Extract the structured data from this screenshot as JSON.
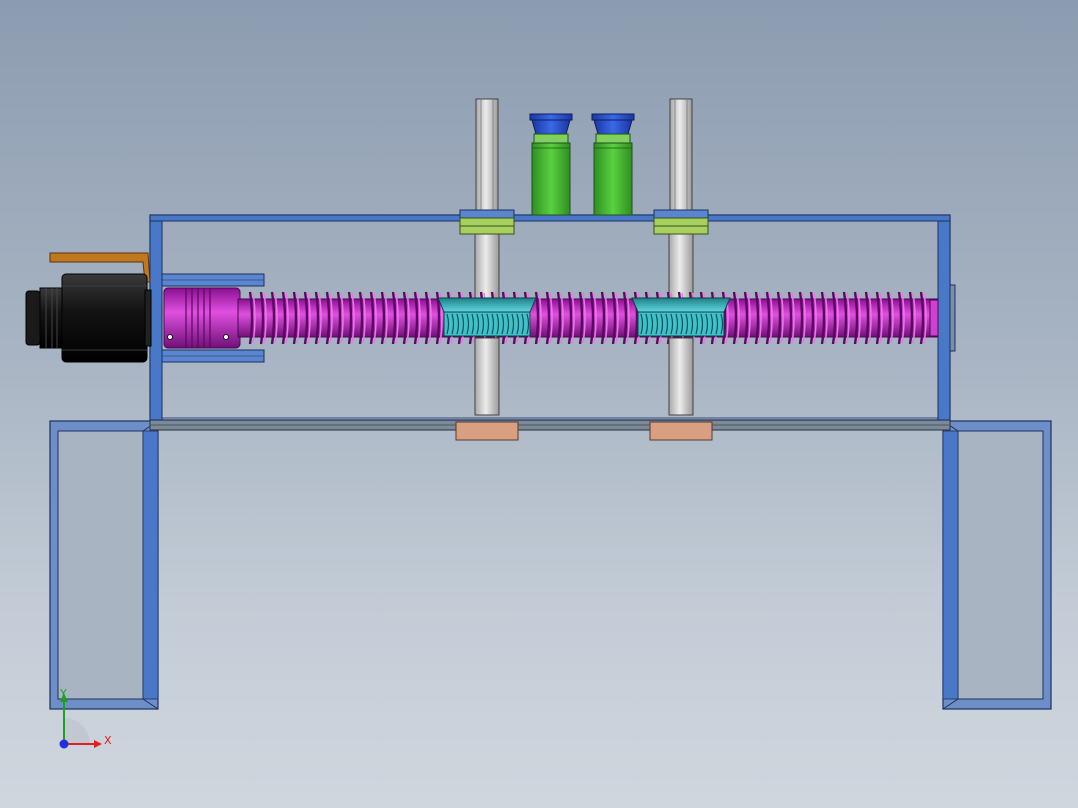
{
  "viewport": {
    "background_top": "#8c9cb0",
    "background_bottom": "#cfd6de"
  },
  "model": {
    "components": {
      "frame": "#4a78c8",
      "leadscrew": "#c020c0",
      "coupling": "#c020c0",
      "motor": "#111111",
      "motor_bracket": "#c07820",
      "guide_rods": "#d4d4d4",
      "cylinders": "#40b830",
      "cylinder_caps": "#2850c8",
      "bushings": "#a8d060",
      "nuts": "#30b0b8",
      "rod_feet": "#d8a080"
    }
  },
  "triad": {
    "x_label": "X",
    "y_label": "Y",
    "x_color": "#e02020",
    "y_color": "#20a020",
    "z_color": "#2030e0"
  }
}
